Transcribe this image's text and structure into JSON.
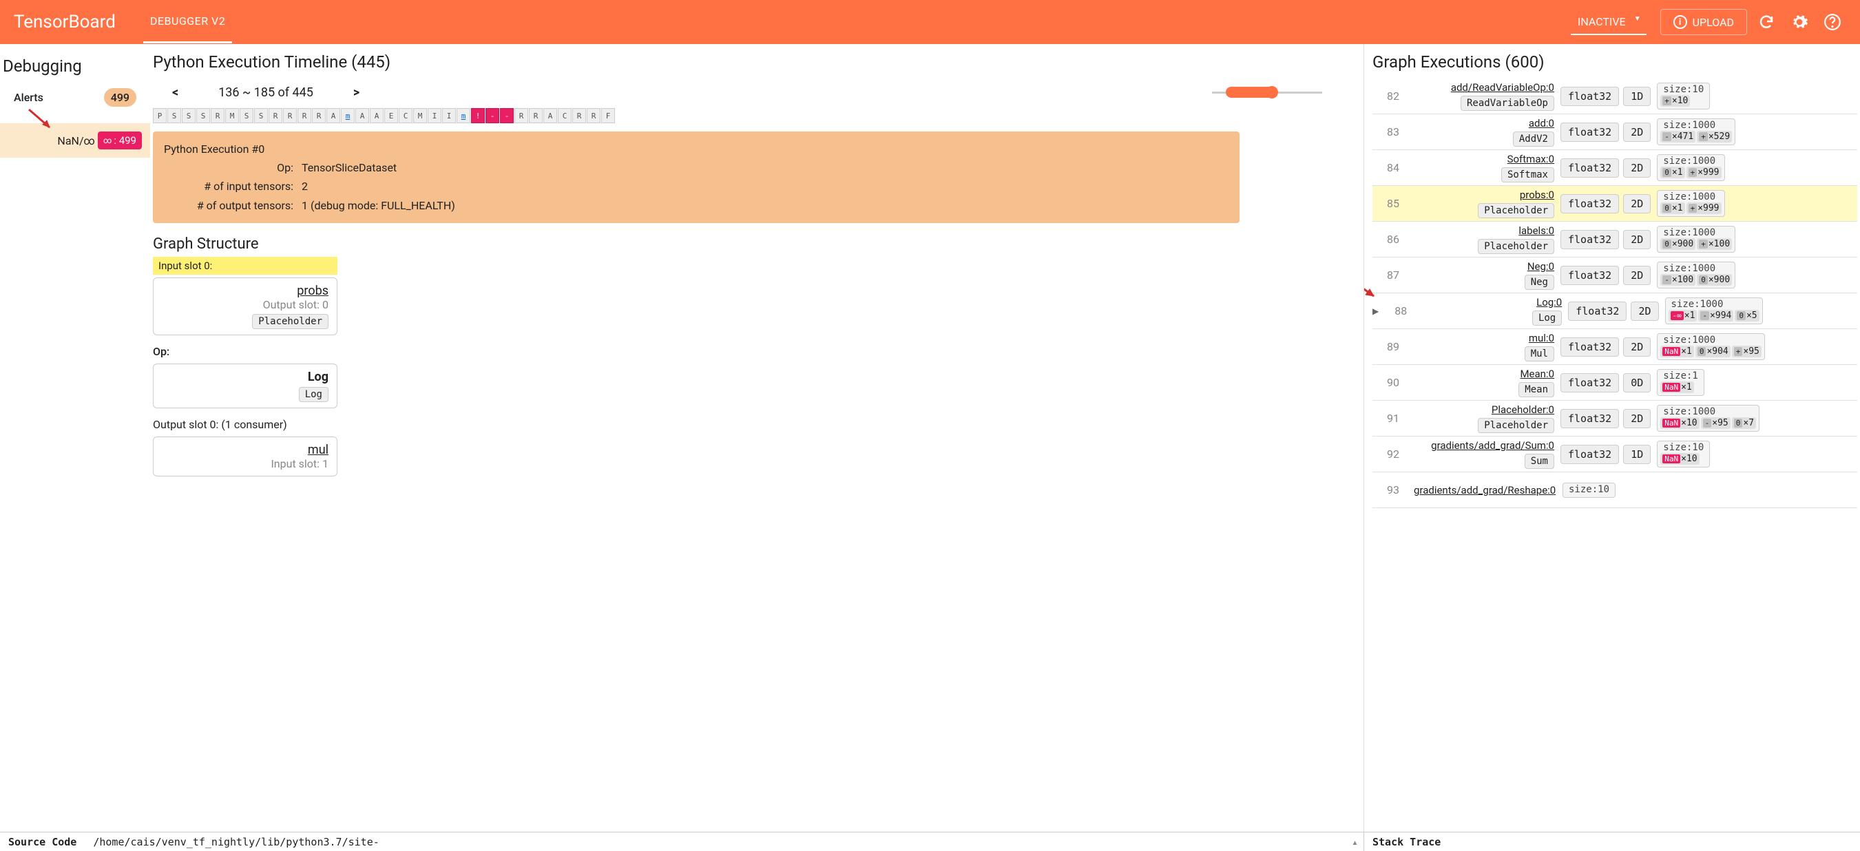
{
  "header": {
    "brand": "TensorBoard",
    "plugin": "DEBUGGER V2",
    "status": "INACTIVE",
    "upload": "UPLOAD"
  },
  "alerts": {
    "panel_title": "Debugging",
    "title": "Alerts",
    "count": "499",
    "type_label": "NaN/∞",
    "type_count": ": 499"
  },
  "timeline": {
    "title": "Python Execution Timeline (445)",
    "prev": "<",
    "range": "136 ~ 185 of 445",
    "next": ">",
    "cells": [
      "P",
      "S",
      "S",
      "S",
      "R",
      "M",
      "S",
      "S",
      "R",
      "R",
      "R",
      "R",
      "A",
      "m",
      "A",
      "A",
      "E",
      "C",
      "M",
      "I",
      "I",
      "m",
      "!",
      "-",
      "-",
      "R",
      "R",
      "A",
      "C",
      "R",
      "R",
      "F"
    ],
    "magenta_idx": [
      22,
      23,
      24
    ],
    "link_idx": [
      13,
      21
    ],
    "exec": {
      "heading": "Python Execution #0",
      "op_k": "Op:",
      "op_v": "TensorSliceDataset",
      "in_k": "# of input tensors:",
      "in_v": "2",
      "out_k": "# of output tensors:",
      "out_v": "1   (debug mode: FULL_HEALTH)"
    }
  },
  "graph_structure": {
    "title": "Graph Structure",
    "input_slot": "Input slot 0:",
    "input": {
      "name": "probs",
      "sub": "Output slot: 0",
      "op": "Placeholder"
    },
    "op_label": "Op:",
    "op": {
      "name": "Log",
      "op": "Log"
    },
    "output_slot": "Output slot 0: (1 consumer)",
    "output": {
      "name": "mul",
      "sub": "Input slot: 1"
    }
  },
  "graph_exec": {
    "title": "Graph Executions (600)",
    "rows": [
      {
        "i": "82",
        "name": "add/ReadVariableOp:0",
        "op": "ReadVariableOp",
        "dt": "float32",
        "sh": "1D",
        "sz": "size:10",
        "ch": [
          {
            "t": "plus",
            "v": "×10"
          }
        ]
      },
      {
        "i": "83",
        "name": "add:0",
        "op": "AddV2",
        "dt": "float32",
        "sh": "2D",
        "sz": "size:1000",
        "ch": [
          {
            "t": "minus",
            "v": "×471"
          },
          {
            "t": "plus",
            "v": "×529"
          }
        ]
      },
      {
        "i": "84",
        "name": "Softmax:0",
        "op": "Softmax",
        "dt": "float32",
        "sh": "2D",
        "sz": "size:1000",
        "ch": [
          {
            "t": "zero",
            "v": "×1"
          },
          {
            "t": "plus",
            "v": "×999"
          }
        ]
      },
      {
        "i": "85",
        "name": "probs:0",
        "op": "Placeholder",
        "dt": "float32",
        "sh": "2D",
        "sz": "size:1000",
        "ch": [
          {
            "t": "zero",
            "v": "×1"
          },
          {
            "t": "plus",
            "v": "×999"
          }
        ],
        "hl": true
      },
      {
        "i": "86",
        "name": "labels:0",
        "op": "Placeholder",
        "dt": "float32",
        "sh": "2D",
        "sz": "size:1000",
        "ch": [
          {
            "t": "zero",
            "v": "×900"
          },
          {
            "t": "plus",
            "v": "×100"
          }
        ]
      },
      {
        "i": "87",
        "name": "Neg:0",
        "op": "Neg",
        "dt": "float32",
        "sh": "2D",
        "sz": "size:1000",
        "ch": [
          {
            "t": "minus",
            "v": "×100"
          },
          {
            "t": "zero",
            "v": "×900"
          }
        ]
      },
      {
        "i": "88",
        "name": "Log:0",
        "op": "Log",
        "dt": "float32",
        "sh": "2D",
        "sz": "size:1000",
        "ch": [
          {
            "t": "inf",
            "v": "×1",
            "lbl": "-∞"
          },
          {
            "t": "minus",
            "v": "×994"
          },
          {
            "t": "zero",
            "v": "×5"
          }
        ],
        "tri": true
      },
      {
        "i": "89",
        "name": "mul:0",
        "op": "Mul",
        "dt": "float32",
        "sh": "2D",
        "sz": "size:1000",
        "ch": [
          {
            "t": "nan",
            "v": "×1",
            "lbl": "NaN"
          },
          {
            "t": "zero",
            "v": "×904"
          },
          {
            "t": "plus",
            "v": "×95"
          }
        ]
      },
      {
        "i": "90",
        "name": "Mean:0",
        "op": "Mean",
        "dt": "float32",
        "sh": "0D",
        "sz": "size:1",
        "ch": [
          {
            "t": "nan",
            "v": "×1",
            "lbl": "NaN"
          }
        ]
      },
      {
        "i": "91",
        "name": "Placeholder:0",
        "op": "Placeholder",
        "dt": "float32",
        "sh": "2D",
        "sz": "size:1000",
        "ch": [
          {
            "t": "nan",
            "v": "×10",
            "lbl": "NaN"
          },
          {
            "t": "minus",
            "v": "×95"
          },
          {
            "t": "zero",
            "v": "×7"
          }
        ]
      },
      {
        "i": "92",
        "name": "gradients/add_grad/Sum:0",
        "op": "Sum",
        "dt": "float32",
        "sh": "1D",
        "sz": "size:10",
        "ch": [
          {
            "t": "nan",
            "v": "×10",
            "lbl": "NaN"
          }
        ]
      },
      {
        "i": "93",
        "name": "gradients/add_grad/Reshape:0",
        "op": "",
        "dt": "",
        "sh": "",
        "sz": "size:10",
        "ch": []
      }
    ]
  },
  "footer": {
    "src": "Source Code",
    "path": "/home/cais/venv_tf_nightly/lib/python3.7/site-",
    "stack": "Stack Trace"
  }
}
